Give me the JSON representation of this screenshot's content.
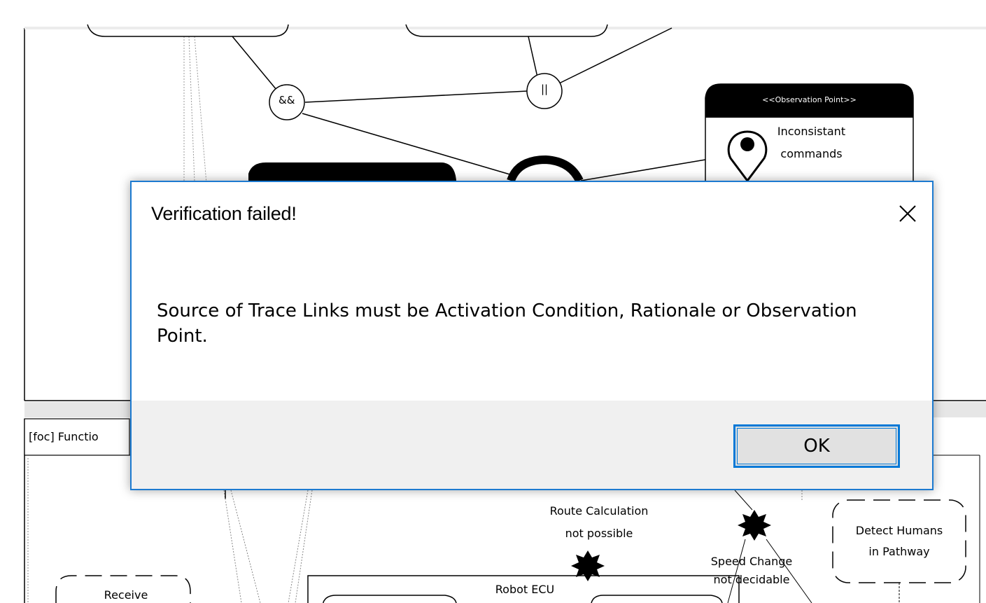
{
  "dialog": {
    "title": "Verification failed!",
    "close_icon": "close-icon",
    "message": "Source of Trace Links must be Activation Condition, Rationale or Observation Point.",
    "ok_label": "OK",
    "accent_color": "#0078d7"
  },
  "diagram": {
    "operator_and": "&&",
    "operator_or": "||",
    "observation_point": {
      "stereotype": "<<Observation Point>>",
      "label_line1": "Inconsistant",
      "label_line2": "commands",
      "icon": "location-pin-icon"
    },
    "lower_tab_label": "[foc] Functio",
    "route_calc_line1": "Route Calculation",
    "route_calc_line2": "not possible",
    "speed_change_line1": "Speed Change",
    "speed_change_line2": "not decidable",
    "detect_humans_line1": "Detect Humans",
    "detect_humans_line2": "in Pathway",
    "robot_ecu": "Robot ECU",
    "receive": "Receive",
    "unknown_icon": "question-burst-icon"
  }
}
